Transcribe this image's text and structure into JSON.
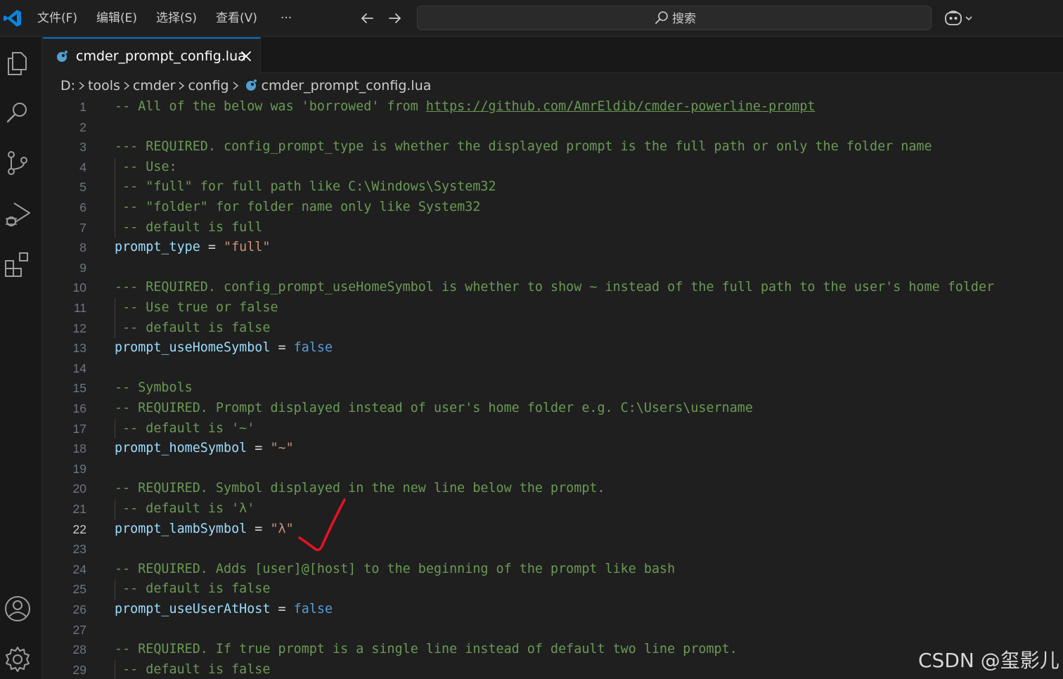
{
  "titlebar": {
    "menus": [
      "文件(F)",
      "编辑(E)",
      "选择(S)",
      "查看(V)",
      "···"
    ],
    "search_label": "搜索"
  },
  "tab": {
    "label": "cmder_prompt_config.lua"
  },
  "breadcrumb": [
    "D:",
    "tools",
    "cmder",
    "config",
    "cmder_prompt_config.lua"
  ],
  "editor": {
    "active_line": 22,
    "lines": [
      "-- All of the below was 'borrowed' from https://github.com/AmrEldib/cmder-powerline-prompt",
      "",
      "--- REQUIRED. config_prompt_type is whether the displayed prompt is the full path or only the folder name",
      " -- Use:",
      " -- \"full\" for full path like C:\\Windows\\System32",
      " -- \"folder\" for folder name only like System32",
      " -- default is full",
      "prompt_type = \"full\"",
      "",
      "--- REQUIRED. config_prompt_useHomeSymbol is whether to show ~ instead of the full path to the user's home folder",
      " -- Use true or false",
      " -- default is false",
      "prompt_useHomeSymbol = false",
      "",
      "-- Symbols",
      "-- REQUIRED. Prompt displayed instead of user's home folder e.g. C:\\Users\\username",
      " -- default is '~'",
      "prompt_homeSymbol = \"~\"",
      "",
      "-- REQUIRED. Symbol displayed in the new line below the prompt.",
      " -- default is 'λ'",
      "prompt_lambSymbol = \"λ\"",
      "",
      "-- REQUIRED. Adds [user]@[host] to the beginning of the prompt like bash",
      " -- default is false",
      "prompt_useUserAtHost = false",
      "",
      "-- REQUIRED. If true prompt is a single line instead of default two line prompt.",
      " -- default is false"
    ]
  },
  "watermark": "CSDN @玺影儿",
  "colors": {
    "accent": "#0078d4",
    "comment": "#6a9955",
    "variable": "#9cdcfe",
    "string": "#ce9178",
    "keyword": "#569cd6",
    "annotation": "#e81123"
  },
  "icons": {
    "activitybar": [
      "explorer-icon",
      "search-icon",
      "source-control-icon",
      "run-debug-icon",
      "extensions-icon",
      "accounts-icon",
      "settings-gear-icon"
    ]
  }
}
